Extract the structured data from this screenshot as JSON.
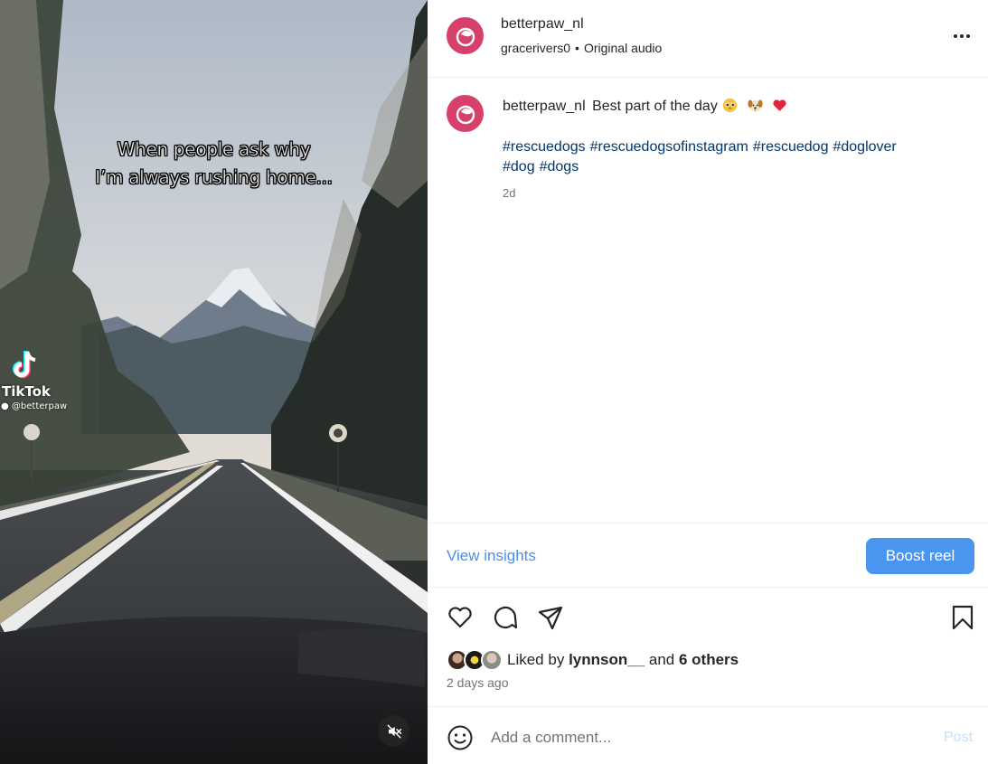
{
  "video": {
    "caption_line1": "When people ask why",
    "caption_line2": "I’m always rushing home...",
    "watermark_brand": "TikTok",
    "watermark_handle": "@betterpaw",
    "mute_icon": "speaker-muted-icon"
  },
  "header": {
    "username": "betterpaw_nl",
    "audio_author": "gracerivers0",
    "separator": "•",
    "audio_label": "Original audio",
    "more_icon": "more-horizontal-icon"
  },
  "post": {
    "username": "betterpaw_nl",
    "caption": "Best part of the day",
    "emojis": [
      "pleading-face-emoji",
      "dog-face-emoji",
      "red-heart-emoji"
    ],
    "hashtags": [
      "#rescuedogs",
      "#rescuedogsofinstagram",
      "#rescuedog",
      "#doglover",
      "#dog",
      "#dogs"
    ],
    "time": "2d"
  },
  "insights": {
    "view_label": "View insights",
    "boost_label": "Boost reel"
  },
  "actions": {
    "like_icon": "heart-icon",
    "comment_icon": "comment-icon",
    "share_icon": "send-icon",
    "save_icon": "bookmark-icon"
  },
  "likes": {
    "prefix": "Liked by",
    "user": "lynnson__",
    "and": "and",
    "others": "6 others",
    "time": "2 days ago"
  },
  "comment": {
    "placeholder": "Add a comment...",
    "post_label": "Post",
    "emoji_icon": "smiley-icon"
  },
  "colors": {
    "avatar_bg": "#d7406a",
    "link_blue": "#4a8fe7",
    "hashtag": "#00376b",
    "boost_bg": "#4a95f0",
    "post_disabled": "#c7dffb",
    "muted_text": "#737373"
  }
}
